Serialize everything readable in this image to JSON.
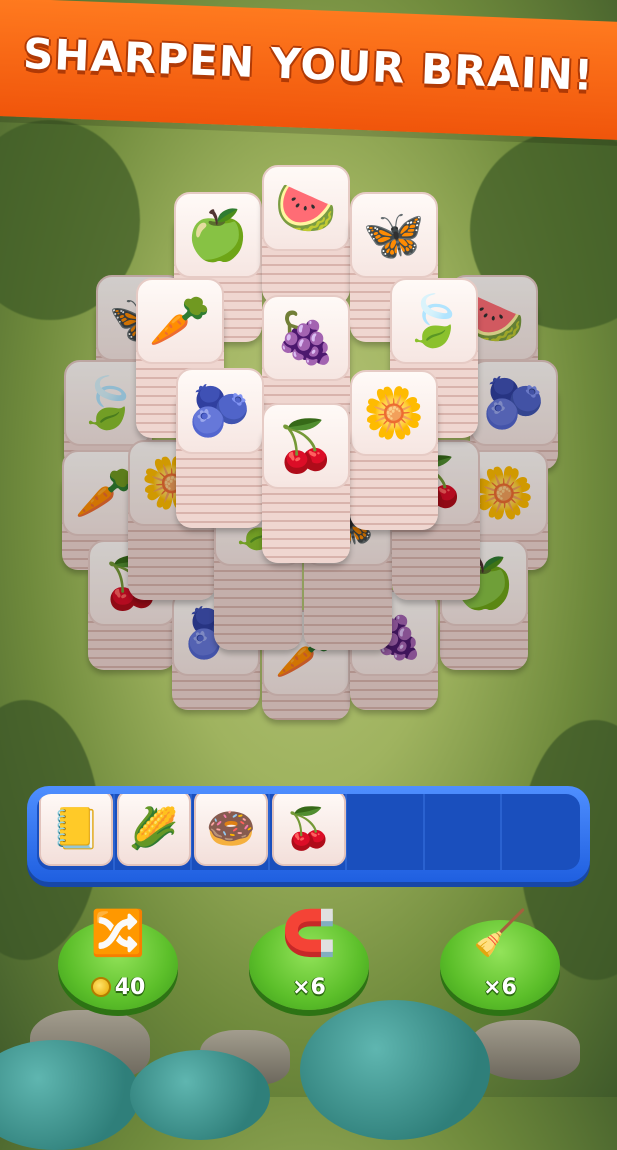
{
  "banner": {
    "title": "SHARPEN YOUR BRAIN!"
  },
  "colors": {
    "banner": "#f0550b",
    "tray": "#1f5fe0",
    "booster": "#5cbf2a",
    "coin": "#e6a800"
  },
  "board": {
    "tiles": [
      {
        "name": "strawberry-tile",
        "icon": "🍉"
      },
      {
        "name": "flower-tile",
        "icon": "🌼"
      },
      {
        "name": "leaf-tile",
        "icon": "🍃"
      },
      {
        "name": "carrot-tile",
        "icon": "🥕"
      },
      {
        "name": "cherry-tile",
        "icon": "🍒"
      },
      {
        "name": "grape-tile",
        "icon": "🍇"
      },
      {
        "name": "blueberry-tile",
        "icon": "🫐"
      },
      {
        "name": "apple-tile",
        "icon": "🍏"
      },
      {
        "name": "butterfly-tile",
        "icon": "🦋"
      }
    ]
  },
  "tray": {
    "slots": [
      {
        "icon": "📒",
        "name": "notebook-tile"
      },
      {
        "icon": "🌽",
        "name": "corn-tile"
      },
      {
        "icon": "🍩",
        "name": "donut-tile"
      },
      {
        "icon": "🍒",
        "name": "cherry-tile"
      },
      {
        "icon": "",
        "name": "empty-slot"
      },
      {
        "icon": "",
        "name": "empty-slot"
      },
      {
        "icon": "",
        "name": "empty-slot"
      }
    ]
  },
  "boosters": [
    {
      "name": "shuffle-booster",
      "icon": "🔀",
      "label": "40",
      "has_coin": true
    },
    {
      "name": "magnet-booster",
      "icon": "🧲",
      "label": "×6",
      "has_coin": false
    },
    {
      "name": "vacuum-booster",
      "icon": "🧹",
      "label": "×6",
      "has_coin": false
    }
  ]
}
